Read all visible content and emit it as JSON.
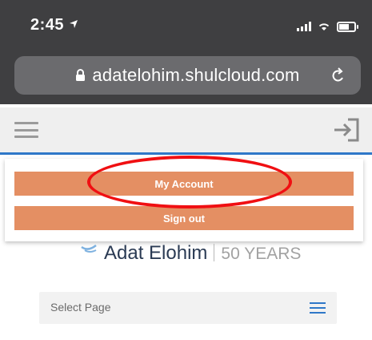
{
  "status_bar": {
    "time": "2:45",
    "location_arrow": "location-arrow-icon"
  },
  "browser": {
    "url": "adatelohim.shulcloud.com"
  },
  "header": {
    "menu_icon": "hamburger-icon",
    "login_icon": "login-icon",
    "accent_color": "#2f78c8"
  },
  "dropdown": {
    "items": [
      {
        "label": "My Account",
        "highlighted": true
      },
      {
        "label": "Sign out"
      }
    ],
    "button_color": "#e48f63",
    "highlight_color": "#f00f12"
  },
  "logo": {
    "name": "Adat Elohim",
    "tagline": "50 YEARS"
  },
  "select_page": {
    "label": "Select Page"
  }
}
